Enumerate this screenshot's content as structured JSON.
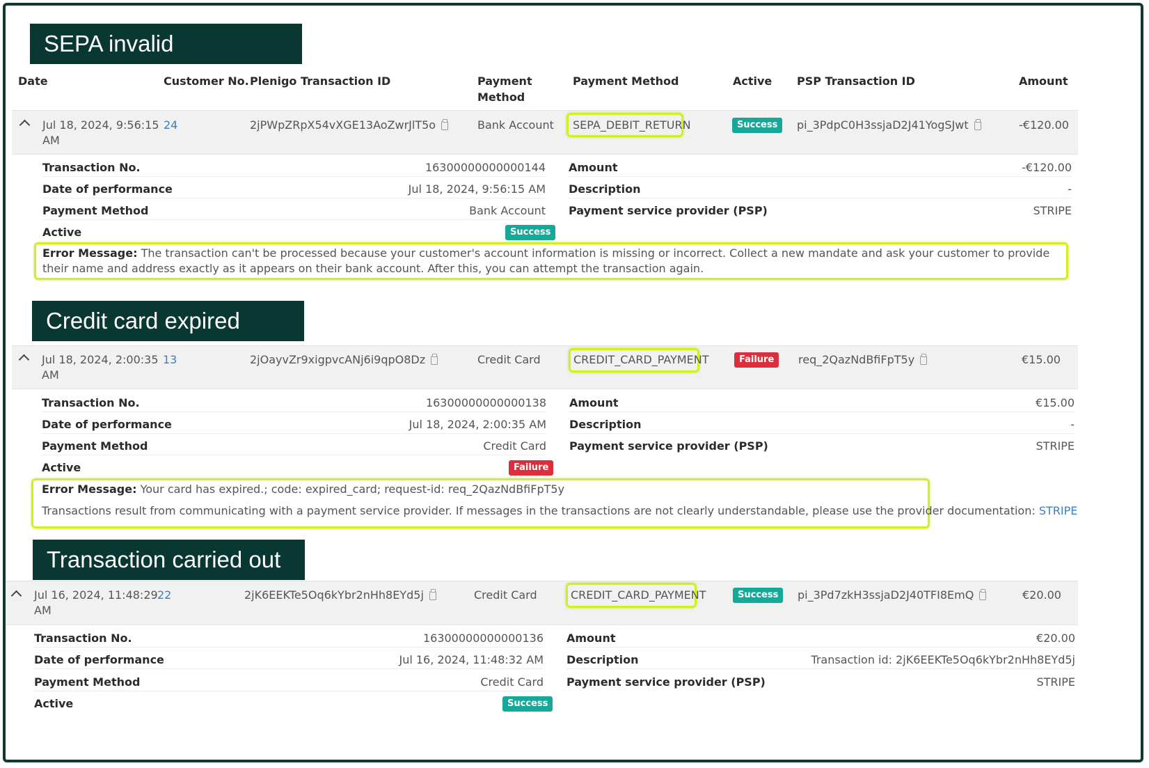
{
  "headers": {
    "date": "Date",
    "customer_no": "Customer No.",
    "plenigo_tx_id": "Plenigo Transaction ID",
    "payment_method": "Payment Method",
    "payment_method2": "Payment Method",
    "active": "Active",
    "psp_tx_id": "PSP Transaction ID",
    "amount": "Amount"
  },
  "detail_labels": {
    "transaction_no": "Transaction No.",
    "date_of_performance": "Date of performance",
    "payment_method": "Payment Method",
    "active": "Active",
    "amount": "Amount",
    "description": "Description",
    "psp": "Payment service provider (PSP)",
    "error_message": "Error Message:"
  },
  "sections": [
    {
      "title": "SEPA invalid",
      "row": {
        "date_line1": "Jul 18, 2024, 9:56:15",
        "date_line2": "AM",
        "customer_no": "24",
        "plenigo_tx_id": "2jPWpZRpX54vXGE13AoZwrJlT5o",
        "payment_method": "Bank Account",
        "payment_type": "SEPA_DEBIT_RETURN",
        "active": "Success",
        "psp_tx_id": "pi_3PdpC0H3ssjaD2J41YogSJwt",
        "amount": "-€120.00"
      },
      "detail": {
        "transaction_no": "16300000000000144",
        "date_of_performance": "Jul 18, 2024, 9:56:15 AM",
        "payment_method": "Bank Account",
        "active": "Success",
        "amount": "-€120.00",
        "description": "-",
        "psp": "STRIPE",
        "error_message": "The transaction can't be processed because your customer's account information is missing or incorrect. Collect a new mandate and ask your customer to provide their name and address exactly as it appears on their bank account. After this, you can attempt the transaction again."
      }
    },
    {
      "title": "Credit card expired",
      "row": {
        "date_line1": "Jul 18, 2024, 2:00:35",
        "date_line2": "AM",
        "customer_no": "13",
        "plenigo_tx_id": "2jOayvZr9xigpvcANj6i9qpO8Dz",
        "payment_method": "Credit Card",
        "payment_type": "CREDIT_CARD_PAYMENT",
        "active": "Failure",
        "psp_tx_id": "req_2QazNdBfiFpT5y",
        "amount": "€15.00"
      },
      "detail": {
        "transaction_no": "16300000000000138",
        "date_of_performance": "Jul 18, 2024, 2:00:35 AM",
        "payment_method": "Credit Card",
        "active": "Failure",
        "amount": "€15.00",
        "description": "-",
        "psp": "STRIPE",
        "error_message": "Your card has expired.; code: expired_card; request-id: req_2QazNdBfiFpT5y",
        "note": "Transactions result from communicating with a payment service provider. If messages in the transactions are not clearly understandable, please use the provider documentation:",
        "note_link": "STRIPE"
      }
    },
    {
      "title": "Transaction carried out",
      "row": {
        "date_line1": "Jul 16, 2024, 11:48:29",
        "date_line2": "AM",
        "customer_no": "22",
        "plenigo_tx_id": "2jK6EEKTe5Oq6kYbr2nHh8EYd5j",
        "payment_method": "Credit Card",
        "payment_type": "CREDIT_CARD_PAYMENT",
        "active": "Success",
        "psp_tx_id": "pi_3Pd7zkH3ssjaD2J40TFI8EmQ",
        "amount": "€20.00"
      },
      "detail": {
        "transaction_no": "16300000000000136",
        "date_of_performance": "Jul 16, 2024, 11:48:32 AM",
        "payment_method": "Credit Card",
        "active": "Success",
        "amount": "€20.00",
        "description": "Transaction id: 2jK6EEKTe5Oq6kYbr2nHh8EYd5j",
        "psp": "STRIPE"
      }
    }
  ],
  "colors": {
    "banner": "#083831",
    "highlight": "#d4f01c",
    "success": "#16a99a",
    "failure": "#dc2f3e",
    "link": "#3a7fc4"
  }
}
